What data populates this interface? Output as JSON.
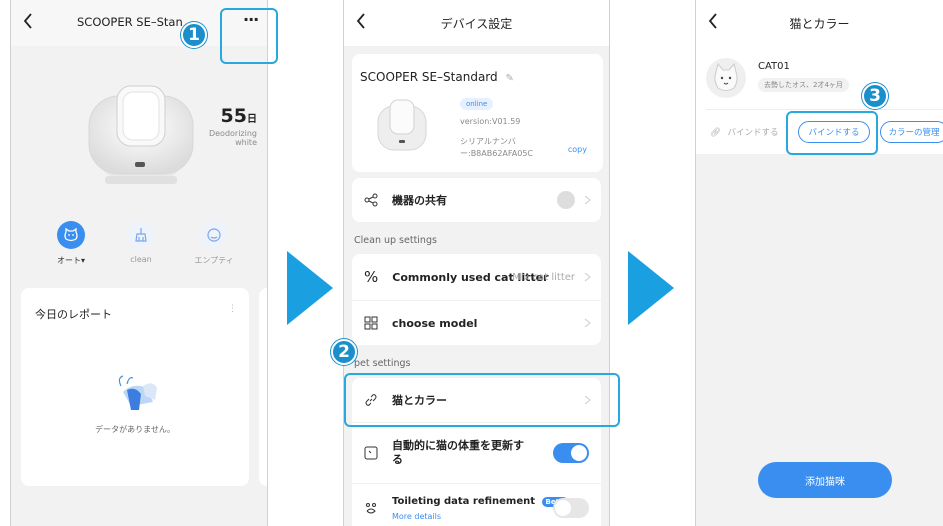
{
  "screen1": {
    "title": "SCOOPER SE–Stan",
    "more_label": "···",
    "days_value": "55",
    "days_unit": "日",
    "status_line1": "Deodorizing",
    "status_line2": "white",
    "modes": [
      {
        "label": "オート▾",
        "icon": "cat-face-icon",
        "active": true
      },
      {
        "label": "clean",
        "icon": "broom-icon",
        "active": false
      },
      {
        "label": "エンプティ",
        "icon": "empty-icon",
        "active": false
      }
    ],
    "report_title": "今日のレポート",
    "report_empty": "データがありません。"
  },
  "screen2": {
    "title": "デバイス設定",
    "device_name": "SCOOPER SE–Standard",
    "online": "online",
    "version": "version:V01.59",
    "serial_line1": "シリアルナンバ",
    "serial_line2": "ー:B8AB62AFA05C",
    "copy": "copy",
    "share": "機器の共有",
    "cleanup_header": "Clean up settings",
    "litter_label": "Commonly used cat litter",
    "litter_value": "Mix cat litter",
    "model_label": "choose model",
    "pet_header": "pet settings",
    "cat_color": "猫とカラー",
    "auto_weight_line1": "自動的に猫の体重を更新す",
    "auto_weight_line2": "る",
    "auto_weight_on": true,
    "toileting": "Toileting data refinement",
    "beta": "Beta",
    "more_details": "More details"
  },
  "screen3": {
    "title": "猫とカラー",
    "cat_name": "CAT01",
    "cat_info": "去勢したオス、2才4ヶ月",
    "bind_label": "バインドする",
    "bind_button": "バインドする",
    "color_button": "カラーの管理",
    "add_button": "添加猫咪"
  },
  "steps": [
    "1",
    "2",
    "3"
  ],
  "colors": {
    "accent": "#3a8ef0",
    "callout": "#29a8dd",
    "arrow": "#1a9fe0"
  }
}
